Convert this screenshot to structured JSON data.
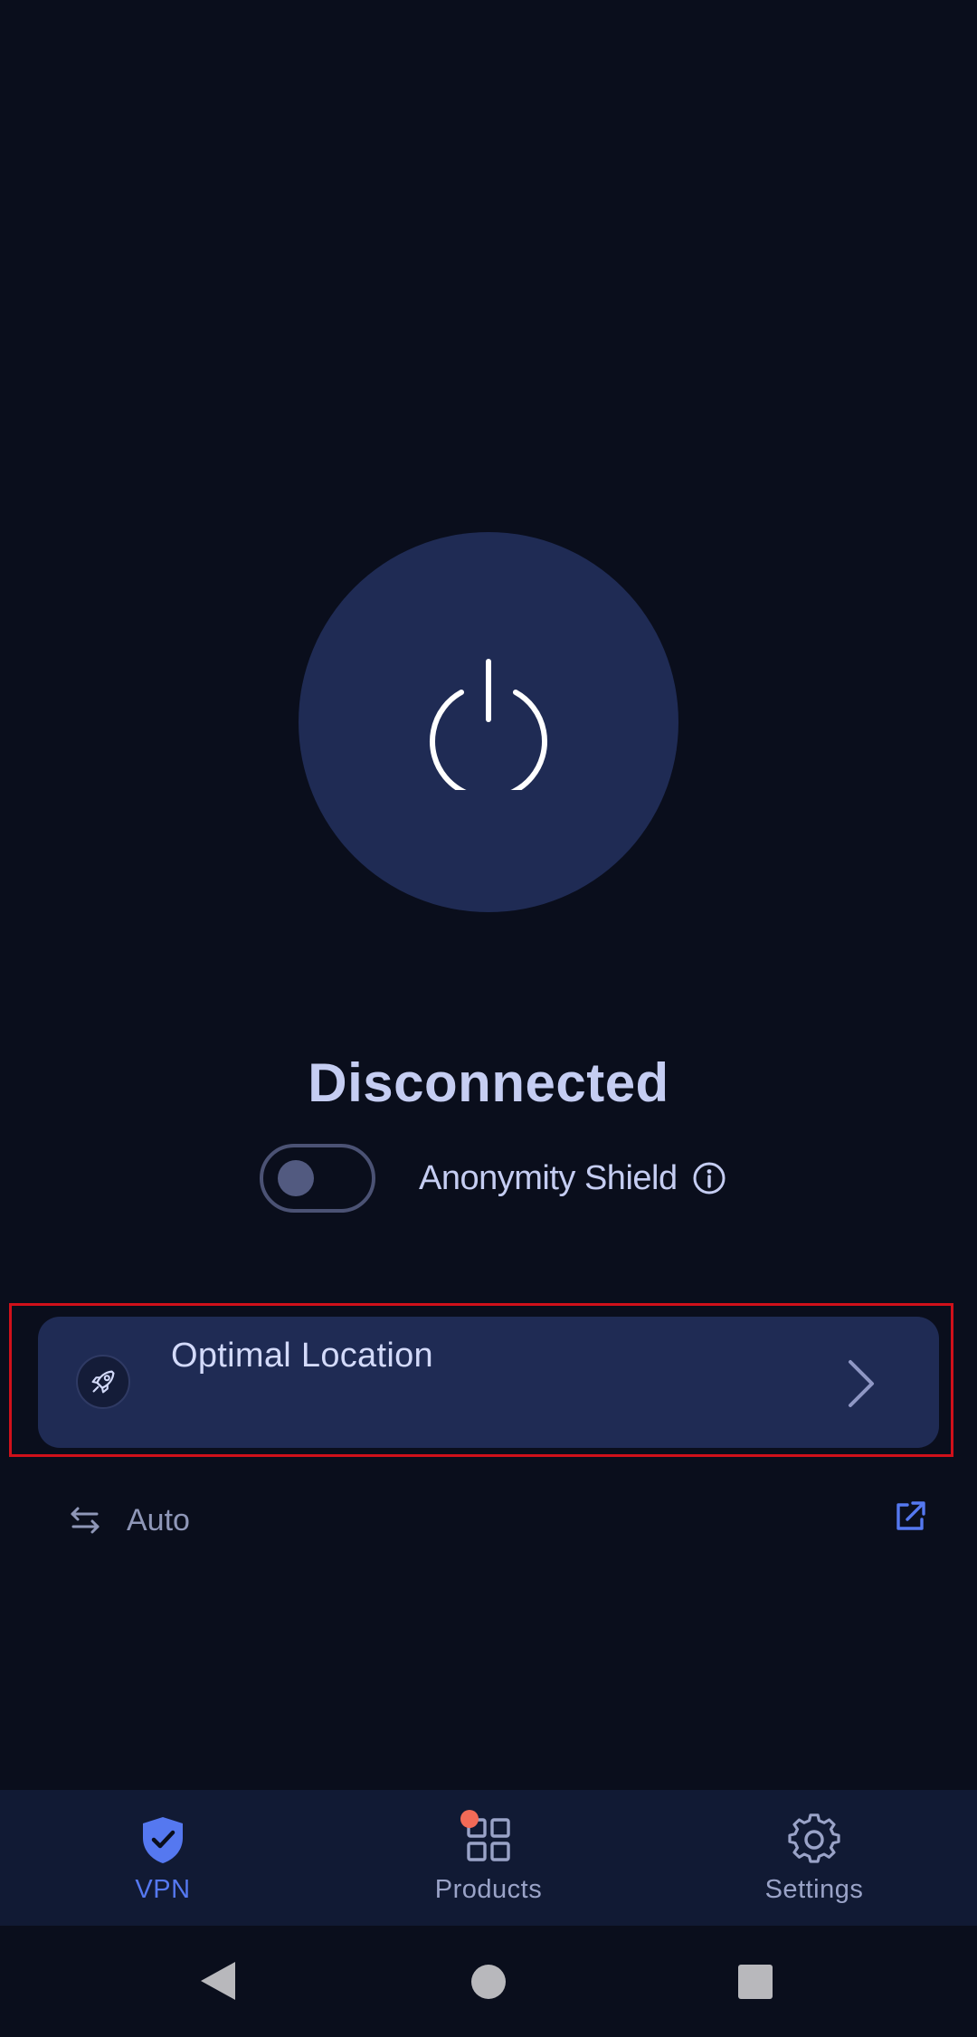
{
  "status": {
    "title": "Disconnected"
  },
  "shield": {
    "label": "Anonymity Shield",
    "enabled": false
  },
  "location": {
    "title": "Optimal Location"
  },
  "protocol": {
    "label": "Auto"
  },
  "nav": {
    "items": [
      {
        "label": "VPN",
        "icon": "shield-check-icon",
        "active": true
      },
      {
        "label": "Products",
        "icon": "grid-icon",
        "active": false,
        "badge": true
      },
      {
        "label": "Settings",
        "icon": "gear-icon",
        "active": false
      }
    ]
  },
  "colors": {
    "background": "#0a0e1c",
    "card": "#1f2b54",
    "accent": "#5578f0",
    "text": "#c5cdf2",
    "badge": "#f26a57",
    "focus_frame": "#d0101a"
  }
}
